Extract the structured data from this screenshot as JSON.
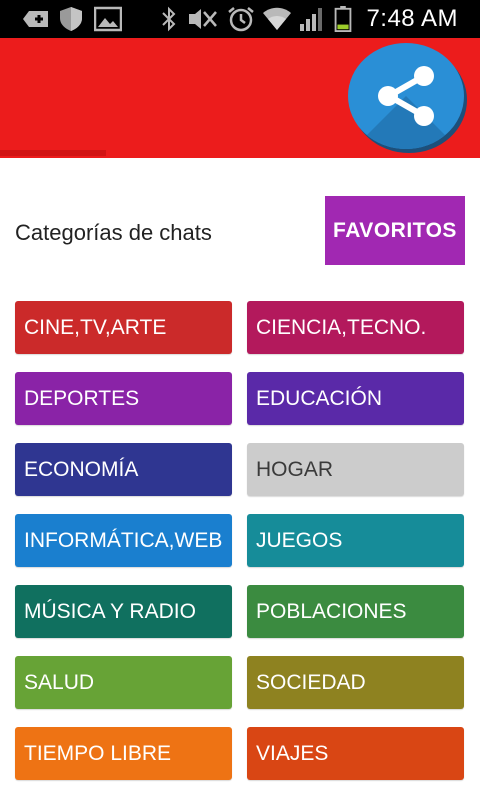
{
  "status_bar": {
    "time": "7:48 AM",
    "icons": [
      "add-box-icon",
      "shield-icon",
      "image-icon",
      "bluetooth-icon",
      "mute-icon",
      "alarm-icon",
      "wifi-icon",
      "signal-icon",
      "battery-icon"
    ]
  },
  "header": {
    "color": "#ec1c1c",
    "share_icon": "share-icon"
  },
  "section": {
    "title": "Categorías de chats",
    "favorites_label": "FAVORITOS"
  },
  "categories": [
    {
      "label": "CINE,TV,ARTE",
      "color": "#cb2a2a"
    },
    {
      "label": "CIENCIA,TECNO.",
      "color": "#b3195c"
    },
    {
      "label": "DEPORTES",
      "color": "#8a23a7"
    },
    {
      "label": "EDUCACIÓN",
      "color": "#5a29a8"
    },
    {
      "label": "ECONOMÍA",
      "color": "#2f3691"
    },
    {
      "label": "HOGAR",
      "color": "#cccccc"
    },
    {
      "label": "INFORMÁTICA,WEB",
      "color": "#1a7fcf"
    },
    {
      "label": "JUEGOS",
      "color": "#168c99"
    },
    {
      "label": "MÚSICA Y RADIO",
      "color": "#10705f"
    },
    {
      "label": "POBLACIONES",
      "color": "#3b8b40"
    },
    {
      "label": "SALUD",
      "color": "#67a336"
    },
    {
      "label": "SOCIEDAD",
      "color": "#8e8220"
    },
    {
      "label": "TIEMPO LIBRE",
      "color": "#ee7314"
    },
    {
      "label": "VIAJES",
      "color": "#d94614"
    }
  ]
}
